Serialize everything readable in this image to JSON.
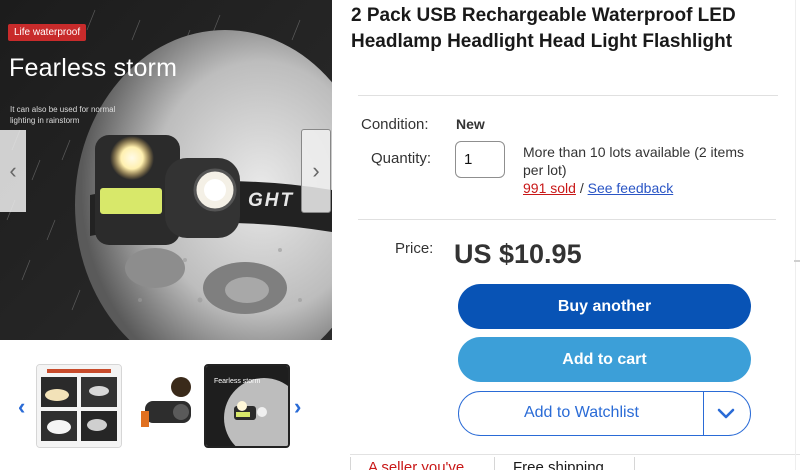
{
  "listing": {
    "title": "2 Pack USB Rechargeable Waterproof LED Headlamp Headlight Head Light Flashlight"
  },
  "gallery": {
    "hero": {
      "badge": "Life waterproof",
      "headline": "Fearless storm",
      "subtext": "It can also be used for normal lighting in rainstorm",
      "strap_text": "GHT"
    },
    "prev_arrow": "‹",
    "next_arrow": "›",
    "thumb_prev": "‹",
    "thumb_next": "›",
    "thumb3_title": "Fearless storm"
  },
  "details": {
    "condition_label": "Condition:",
    "condition_value": "New",
    "quantity_label": "Quantity:",
    "quantity_value": "1",
    "availability": "More than 10 lots available (2 items per lot)",
    "sold": "991 sold",
    "separator": "/",
    "feedback": "See feedback",
    "price_label": "Price:",
    "price": "US $10.95"
  },
  "actions": {
    "buy": "Buy another",
    "cart": "Add to cart",
    "watch": "Add to Watchlist"
  },
  "tabs": {
    "seller": "A seller you've",
    "shipping": "Free shipping"
  },
  "colors": {
    "buy_button": "#0853b5",
    "cart_button": "#3c9fd8",
    "link": "#2a55c5",
    "sold": "#c81717"
  }
}
